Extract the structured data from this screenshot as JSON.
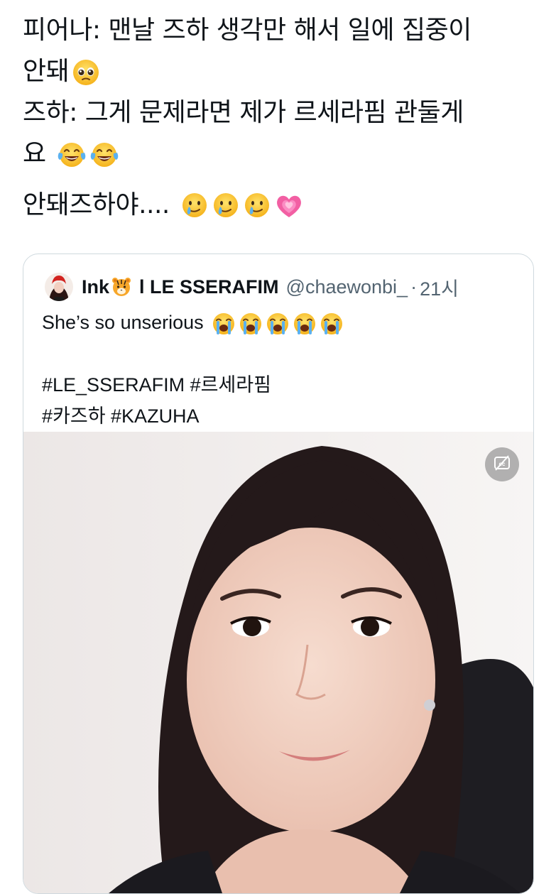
{
  "tweet": {
    "lines": [
      "피어나: 맨날 즈하 생각만 해서 일에 집중이",
      "안돼",
      "즈하: 그게 문제라면 제가 르세라핌 관둘게",
      "요",
      "안돼즈하야...."
    ],
    "emoji": {
      "line2": [
        "pleading-face"
      ],
      "line4": [
        "tears-of-joy",
        "tears-of-joy"
      ],
      "line5": [
        "smiling-face-with-tear",
        "smiling-face-with-tear",
        "smiling-face-with-tear",
        "growing-heart"
      ]
    }
  },
  "quote": {
    "display_name": "Ink",
    "name_emoji": "tiger-face",
    "display_name_suffix": "l LE SSERAFIM",
    "handle": "@chaewonbi_",
    "separator": "·",
    "time": "21시",
    "text": "She’s so unserious",
    "text_emoji": [
      "loudly-crying",
      "loudly-crying",
      "loudly-crying",
      "loudly-crying",
      "loudly-crying"
    ],
    "hashtags_line1": "#LE_SSERAFIM #르세라핌",
    "hashtags_line2": "#카즈하 #KAZUHA",
    "media_button_icon": "captions-off-icon"
  },
  "colors": {
    "text": "#0f1419",
    "secondary": "#536471",
    "border": "#cfd9de"
  }
}
